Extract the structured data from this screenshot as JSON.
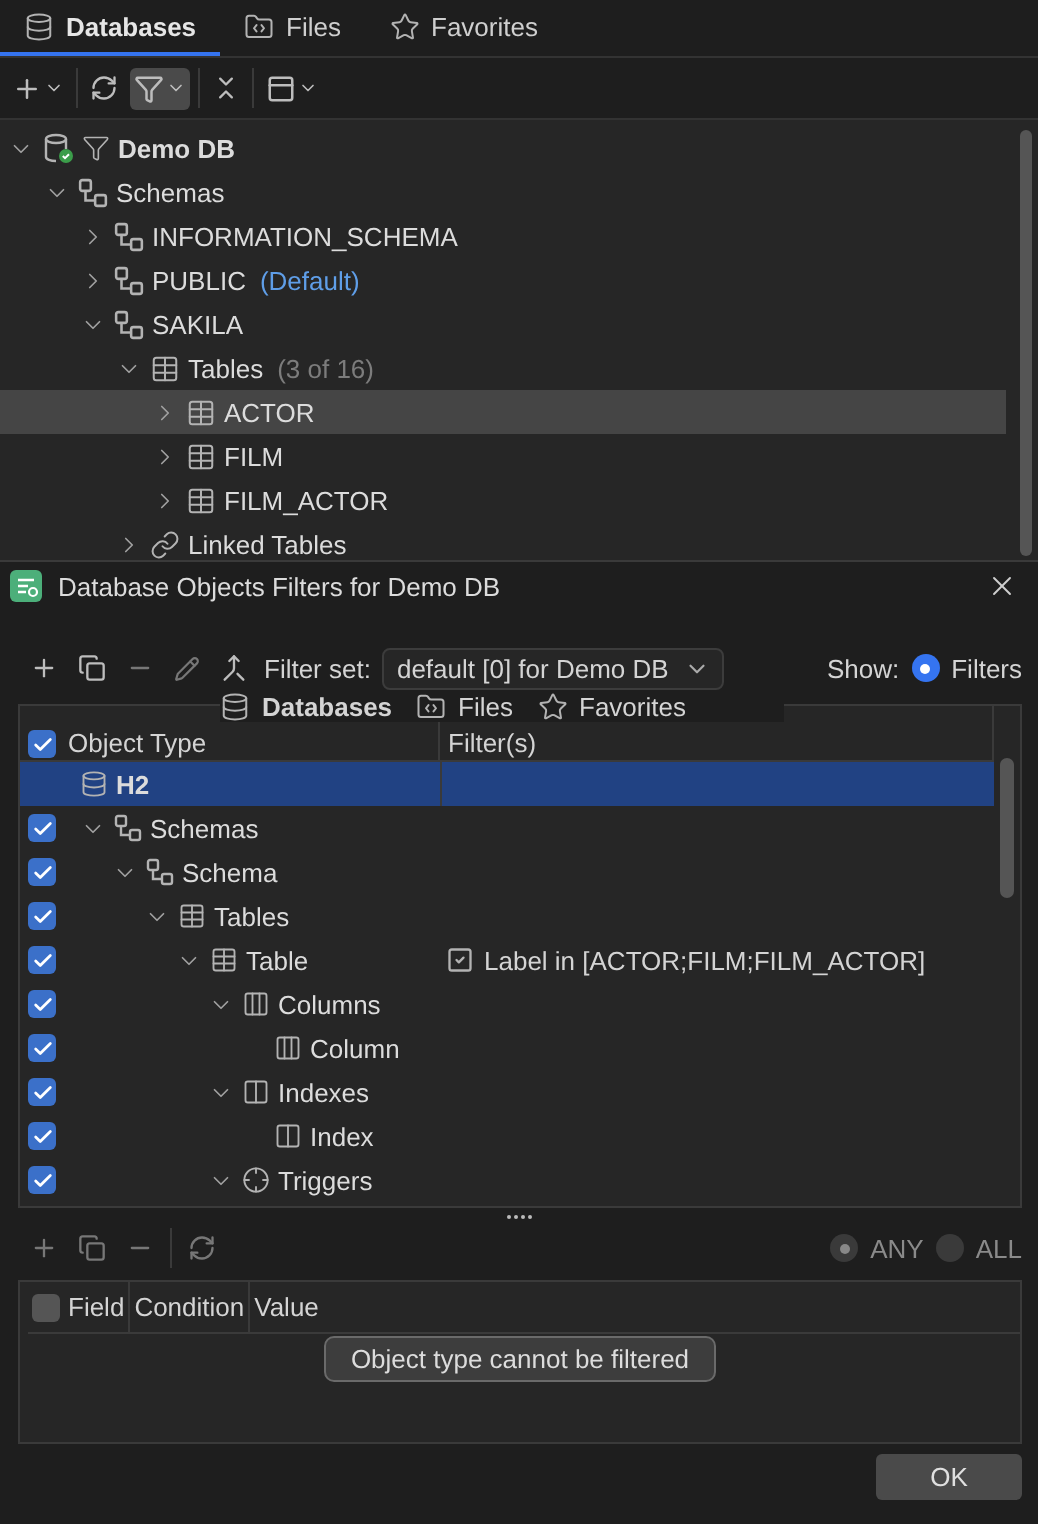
{
  "navigator": {
    "tabs": [
      {
        "label": "Databases",
        "kind": "database",
        "selected": true
      },
      {
        "label": "Files",
        "kind": "folder",
        "selected": false
      },
      {
        "label": "Favorites",
        "kind": "star",
        "selected": false
      }
    ],
    "filter_active": true,
    "tree": [
      {
        "label": "Demo DB",
        "kind": "connection",
        "expanded": true,
        "selected": false,
        "children": [
          {
            "label": "Schemas",
            "kind": "schemas",
            "expanded": true,
            "selected": false,
            "children": [
              {
                "label": "INFORMATION_SCHEMA",
                "kind": "schema",
                "expanded": false,
                "selected": false
              },
              {
                "label": "PUBLIC",
                "kind": "schema",
                "note": "(Default)",
                "expanded": false,
                "selected": false
              },
              {
                "label": "SAKILA",
                "kind": "schema",
                "expanded": true,
                "selected": false,
                "children": [
                  {
                    "label": "Tables",
                    "kind": "tables",
                    "note": "(3 of 16)",
                    "expanded": true,
                    "selected": false,
                    "children": [
                      {
                        "label": "ACTOR",
                        "kind": "table",
                        "expanded": false,
                        "selected": true
                      },
                      {
                        "label": "FILM",
                        "kind": "table",
                        "expanded": false,
                        "selected": false
                      },
                      {
                        "label": "FILM_ACTOR",
                        "kind": "table",
                        "expanded": false,
                        "selected": false
                      }
                    ]
                  },
                  {
                    "label": "Linked Tables",
                    "kind": "link",
                    "expanded": false,
                    "selected": false
                  }
                ]
              }
            ]
          }
        ]
      }
    ]
  },
  "dialog": {
    "title": "Database Objects Filters for Demo DB",
    "filter_set_label": "Filter set:",
    "filter_set_value": "default [0] for Demo DB",
    "show_label": "Show:",
    "show_options": [
      {
        "label": "Filters",
        "selected": true
      }
    ],
    "ghost_tabs": [
      {
        "label": "Databases",
        "kind": "database",
        "selected": true
      },
      {
        "label": "Files",
        "kind": "folder",
        "selected": false
      },
      {
        "label": "Favorites",
        "kind": "star",
        "selected": false
      }
    ],
    "columns": [
      "Object Type",
      "Filter(s)"
    ],
    "all_checked": true,
    "rows": [
      {
        "kind": "database",
        "label": "H2",
        "selected": true,
        "children": [
          {
            "kind": "schema",
            "label": "Schemas",
            "checked": true,
            "expanded": true,
            "selected": false,
            "children": [
              {
                "kind": "schema",
                "label": "Schema",
                "checked": true,
                "expanded": true,
                "selected": false,
                "children": [
                  {
                    "kind": "table",
                    "label": "Tables",
                    "checked": true,
                    "expanded": true,
                    "selected": false,
                    "children": [
                      {
                        "kind": "table",
                        "label": "Table",
                        "checked": true,
                        "expanded": true,
                        "selected": false,
                        "filter": "Label in [ACTOR;FILM;FILM_ACTOR]",
                        "filter_enabled": true,
                        "children": [
                          {
                            "kind": "columns",
                            "label": "Columns",
                            "checked": true,
                            "expanded": true,
                            "selected": false,
                            "children": [
                              {
                                "kind": "columns",
                                "label": "Column",
                                "checked": true,
                                "selected": false
                              }
                            ]
                          },
                          {
                            "kind": "index",
                            "label": "Indexes",
                            "checked": true,
                            "expanded": true,
                            "selected": false,
                            "children": [
                              {
                                "kind": "index",
                                "label": "Index",
                                "checked": true,
                                "selected": false
                              }
                            ]
                          },
                          {
                            "kind": "trigger",
                            "label": "Triggers",
                            "checked": true,
                            "expanded": true,
                            "selected": false
                          }
                        ]
                      }
                    ]
                  }
                ]
              }
            ]
          }
        ]
      }
    ],
    "match_options": [
      {
        "label": "ANY",
        "selected": true
      },
      {
        "label": "ALL",
        "selected": false
      }
    ],
    "condition_columns": [
      "Field",
      "Condition",
      "Value"
    ],
    "conditions_checked": false,
    "message": "Object type cannot be filtered",
    "buttons": [
      "OK"
    ]
  }
}
